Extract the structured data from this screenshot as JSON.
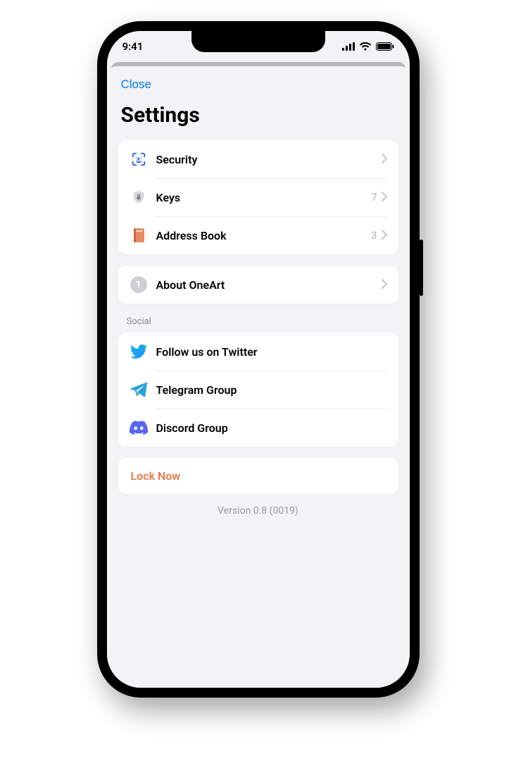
{
  "status": {
    "time": "9:41"
  },
  "close_label": "Close",
  "title": "Settings",
  "groups": {
    "main": {
      "security": {
        "label": "Security"
      },
      "keys": {
        "label": "Keys",
        "value": "7"
      },
      "address": {
        "label": "Address Book",
        "value": "3"
      }
    },
    "about": {
      "label": "About OneArt",
      "badge": "1"
    },
    "social": {
      "header": "Social",
      "twitter": {
        "label": "Follow us on Twitter"
      },
      "telegram": {
        "label": "Telegram Group"
      },
      "discord": {
        "label": "Discord Group"
      }
    }
  },
  "lock_label": "Lock Now",
  "version": "Version 0.8 (0019)",
  "colors": {
    "link": "#007aff",
    "accent_orange": "#e86f3a",
    "twitter": "#1da1f2",
    "telegram": "#29a0dc",
    "discord": "#5865f2",
    "faceid": "#2f5fe0",
    "book": "#e58a61"
  }
}
